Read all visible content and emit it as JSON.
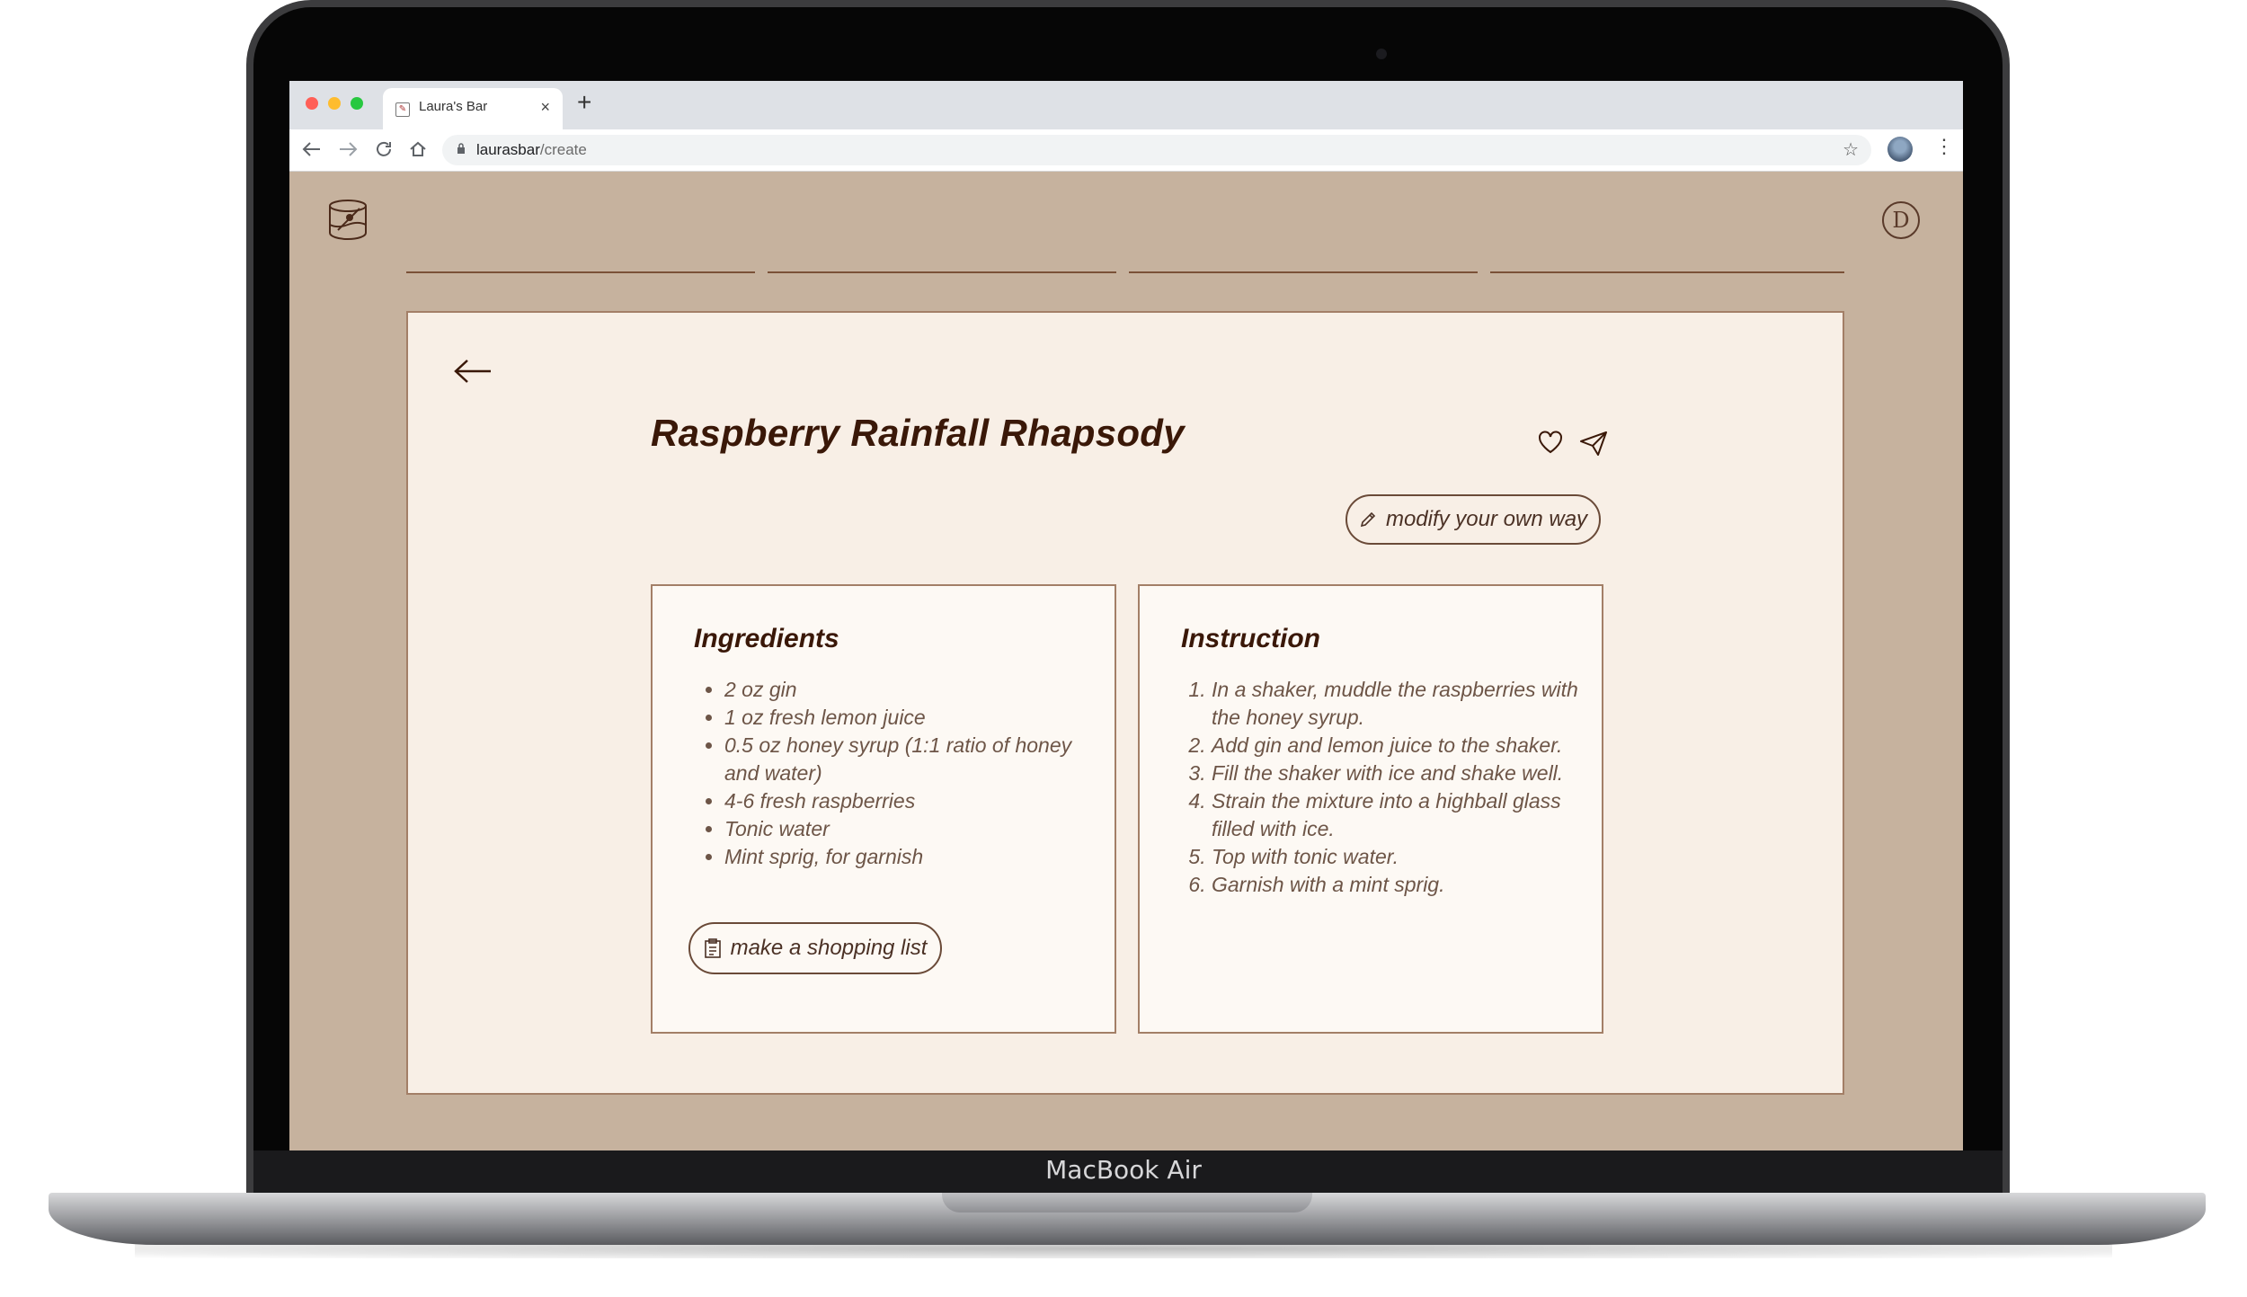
{
  "device": {
    "brand_label": "MacBook Air"
  },
  "browser": {
    "tab": {
      "title": "Laura's Bar",
      "close_glyph": "×"
    },
    "new_tab_glyph": "+",
    "url_host": "laurasbar",
    "url_path": "/create",
    "icons": [
      "back-icon",
      "forward-icon",
      "reload-icon",
      "home-icon",
      "lock-icon",
      "bookmark-star-icon",
      "profile-avatar",
      "menu-icon"
    ]
  },
  "header": {
    "user_initial": "D"
  },
  "recipe": {
    "title": "Raspberry Rainfall Rhapsody",
    "modify_label": "modify your own way",
    "ingredients": {
      "heading": "Ingredients",
      "items": [
        "2 oz gin",
        "1 oz fresh lemon juice",
        "0.5 oz honey syrup (1:1 ratio of honey and water)",
        "4-6 fresh raspberries",
        "Tonic water",
        "Mint sprig, for garnish"
      ],
      "shopping_label": "make a shopping list"
    },
    "instruction": {
      "heading": "Instruction",
      "steps": [
        "In a shaker, muddle the raspberries with the honey syrup.",
        "Add gin and lemon juice to the shaker.",
        "Fill the shaker with ice and shake well.",
        "Strain the mixture into a highball glass filled with ice.",
        "Top with tonic water.",
        "Garnish with a mint sprig."
      ]
    }
  },
  "colors": {
    "page_bg": "#c6b29e",
    "card_bg": "#f8efe6",
    "panel_bg": "#fdf9f4",
    "text_dark": "#3a1808",
    "text_muted": "#6d5547"
  }
}
